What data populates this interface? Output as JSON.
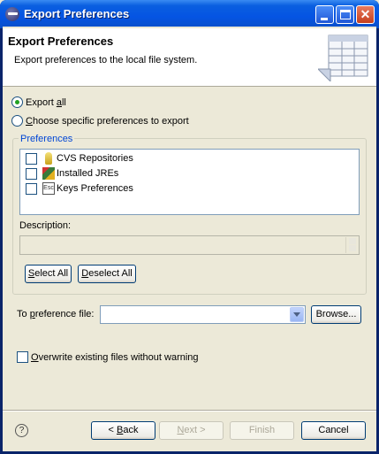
{
  "window": {
    "title": "Export Preferences"
  },
  "banner": {
    "title": "Export Preferences",
    "description": "Export preferences to the local file system."
  },
  "radios": {
    "export_all": {
      "label_pre": "Export ",
      "label_mnemonic": "a",
      "label_post": "ll",
      "selected": true
    },
    "choose_specific": {
      "label_pre": "",
      "label_mnemonic": "C",
      "label_post": "hoose specific preferences to export",
      "selected": false
    }
  },
  "preferences_group": {
    "label": "Preferences",
    "items": [
      {
        "label": "CVS Repositories",
        "icon": "cvs-repository-icon",
        "checked": false
      },
      {
        "label": "Installed JREs",
        "icon": "jre-icon",
        "checked": false
      },
      {
        "label": "Keys Preferences",
        "icon": "keys-icon",
        "icon_text": "Esc",
        "checked": false
      }
    ],
    "description_label": "Description:",
    "description_value": "",
    "select_all": {
      "pre": "",
      "mnemonic": "S",
      "post": "elect All"
    },
    "deselect_all": {
      "pre": "",
      "mnemonic": "D",
      "post": "eselect All"
    }
  },
  "to_file": {
    "label_pre": "To ",
    "label_mnemonic": "p",
    "label_post": "reference file:",
    "value": "",
    "browse_label": "Browse..."
  },
  "overwrite": {
    "label_pre": "",
    "label_mnemonic": "O",
    "label_post": "verwrite existing files without warning",
    "checked": false
  },
  "footer": {
    "help_icon": "help-icon",
    "help_glyph": "?",
    "back": {
      "pre": "< ",
      "mnemonic": "B",
      "post": "ack"
    },
    "next": {
      "pre": "",
      "mnemonic": "N",
      "post": "ext >"
    },
    "finish": "Finish",
    "cancel": "Cancel"
  },
  "colors": {
    "titlebar": "#0554E3",
    "group_label": "#0046D5",
    "dialog_bg": "#ECE9D8"
  }
}
